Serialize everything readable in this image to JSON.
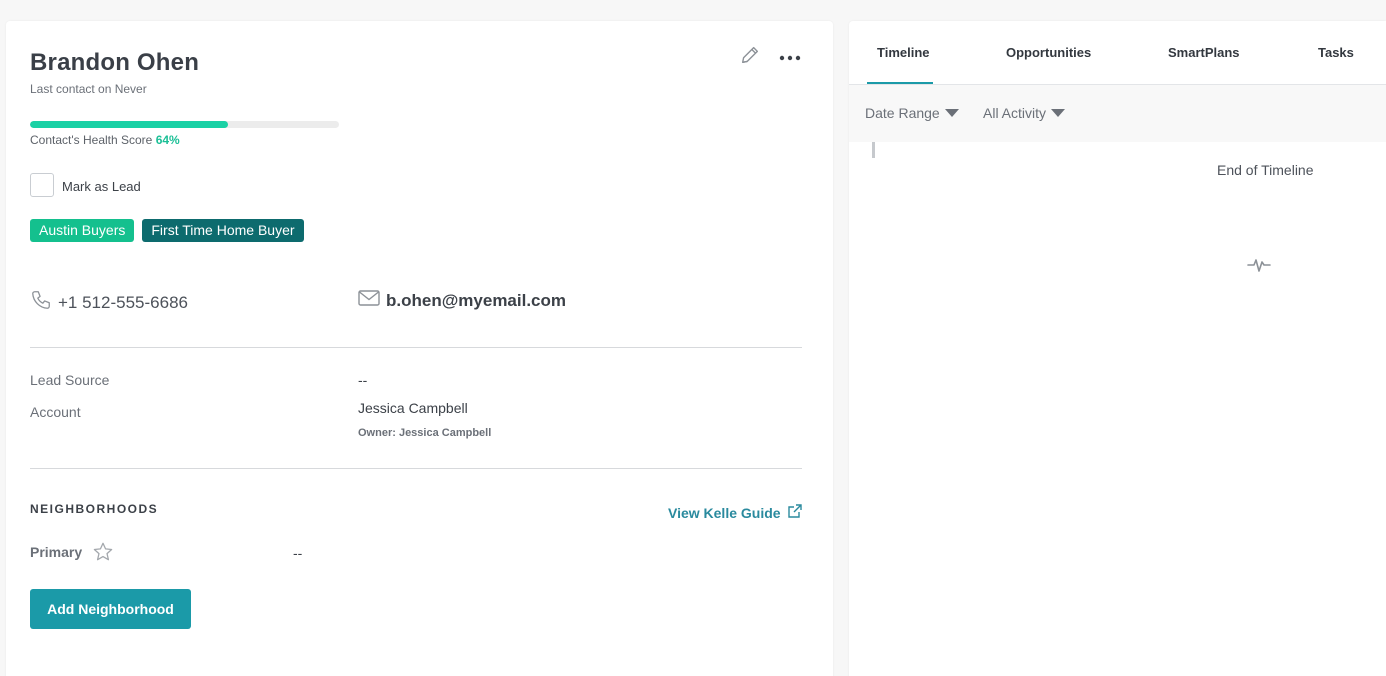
{
  "contact": {
    "name": "Brandon Ohen",
    "last_contact": "Last contact on Never",
    "health_label": "Contact's Health Score",
    "health_pct": "64%",
    "health_value": 0.64,
    "mark_lead": "Mark as Lead",
    "tags": [
      {
        "label": "Austin Buyers",
        "color": "#14c08e"
      },
      {
        "label": "First Time Home Buyer",
        "color": "#0d6b6e"
      }
    ],
    "phone": "+1 512-555-6686",
    "email": "b.ohen@myemail.com",
    "lead_source_label": "Lead Source",
    "lead_source_value": "--",
    "account_label": "Account",
    "account_value": "Jessica Campbell",
    "owner": "Owner: Jessica Campbell"
  },
  "neighborhoods": {
    "title": "NEIGHBORHOODS",
    "guide_link": "View Kelle Guide",
    "primary_label": "Primary",
    "primary_value": "--",
    "add_button": "Add Neighborhood"
  },
  "timeline": {
    "tabs": [
      "Timeline",
      "Opportunities",
      "SmartPlans",
      "Tasks"
    ],
    "active_tab": "Timeline",
    "filters": [
      "Date Range",
      "All Activity"
    ],
    "end_text": "End of Timeline"
  },
  "icons": {
    "edit": "pencil-icon",
    "more": "more-dots-icon",
    "phone": "phone-icon",
    "email": "envelope-icon",
    "external": "external-link-icon",
    "star": "star-icon",
    "dropdown": "caret-down-icon",
    "activity": "activity-pulse-icon"
  },
  "colors": {
    "accent": "#1b9aa8",
    "health": "#1ad1a5",
    "tag_green": "#14c08e",
    "tag_teal": "#0d6b6e"
  }
}
